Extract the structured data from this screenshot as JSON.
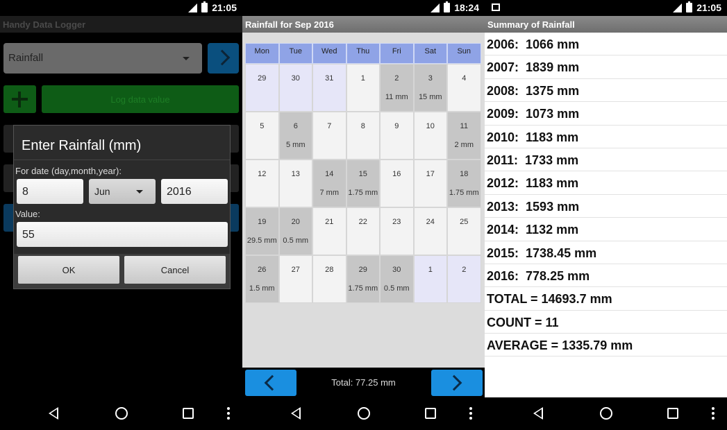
{
  "screen1": {
    "status_time": "21:05",
    "title": "Handy Data Logger",
    "category_spinner": "Rainfall",
    "log_button_label": "Log data value",
    "dialog": {
      "title": "Enter Rainfall (mm)",
      "date_label": "For date (day,month,year):",
      "day": "8",
      "month": "Jun",
      "year": "2016",
      "value_label": "Value:",
      "value": "55",
      "ok_label": "OK",
      "cancel_label": "Cancel"
    }
  },
  "screen2": {
    "status_time": "18:24",
    "title": "Rainfall for Sep 2016",
    "weekdays": [
      "Mon",
      "Tue",
      "Wed",
      "Thu",
      "Fri",
      "Sat",
      "Sun"
    ],
    "weeks": [
      [
        {
          "d": "29",
          "v": "",
          "t": "out"
        },
        {
          "d": "30",
          "v": "",
          "t": "out"
        },
        {
          "d": "31",
          "v": "",
          "t": "out"
        },
        {
          "d": "1",
          "v": "",
          "t": "in"
        },
        {
          "d": "2",
          "v": "11 mm",
          "t": "has"
        },
        {
          "d": "3",
          "v": "15 mm",
          "t": "has"
        },
        {
          "d": "4",
          "v": "",
          "t": "in"
        }
      ],
      [
        {
          "d": "5",
          "v": "",
          "t": "in"
        },
        {
          "d": "6",
          "v": "5 mm",
          "t": "has"
        },
        {
          "d": "7",
          "v": "",
          "t": "in"
        },
        {
          "d": "8",
          "v": "",
          "t": "in"
        },
        {
          "d": "9",
          "v": "",
          "t": "in"
        },
        {
          "d": "10",
          "v": "",
          "t": "in"
        },
        {
          "d": "11",
          "v": "2 mm",
          "t": "has"
        }
      ],
      [
        {
          "d": "12",
          "v": "",
          "t": "in"
        },
        {
          "d": "13",
          "v": "",
          "t": "in"
        },
        {
          "d": "14",
          "v": "7 mm",
          "t": "has"
        },
        {
          "d": "15",
          "v": "1.75 mm",
          "t": "has"
        },
        {
          "d": "16",
          "v": "",
          "t": "in"
        },
        {
          "d": "17",
          "v": "",
          "t": "in"
        },
        {
          "d": "18",
          "v": "1.75 mm",
          "t": "has"
        }
      ],
      [
        {
          "d": "19",
          "v": "29.5 mm",
          "t": "has"
        },
        {
          "d": "20",
          "v": "0.5 mm",
          "t": "has"
        },
        {
          "d": "21",
          "v": "",
          "t": "in"
        },
        {
          "d": "22",
          "v": "",
          "t": "in"
        },
        {
          "d": "23",
          "v": "",
          "t": "in"
        },
        {
          "d": "24",
          "v": "",
          "t": "in"
        },
        {
          "d": "25",
          "v": "",
          "t": "in"
        }
      ],
      [
        {
          "d": "26",
          "v": "1.5 mm",
          "t": "has"
        },
        {
          "d": "27",
          "v": "",
          "t": "in"
        },
        {
          "d": "28",
          "v": "",
          "t": "in"
        },
        {
          "d": "29",
          "v": "1.75 mm",
          "t": "has"
        },
        {
          "d": "30",
          "v": "0.5 mm",
          "t": "has"
        },
        {
          "d": "1",
          "v": "",
          "t": "out"
        },
        {
          "d": "2",
          "v": "",
          "t": "out"
        }
      ]
    ],
    "total_label": "Total: 77.25 mm"
  },
  "screen3": {
    "status_time": "21:05",
    "title": "Summary of Rainfall",
    "rows": [
      "2006:  1066 mm",
      "2007:  1839 mm",
      "2008:  1375 mm",
      "2009:  1073 mm",
      "2010:  1183 mm",
      "2011:  1733 mm",
      "2012:  1183 mm",
      "2013:  1593 mm",
      "2014:  1132 mm",
      "2015:  1738.45 mm",
      "2016:  778.25 mm",
      "TOTAL = 14693.7 mm",
      "COUNT = 11",
      "AVERAGE = 1335.79 mm"
    ]
  }
}
